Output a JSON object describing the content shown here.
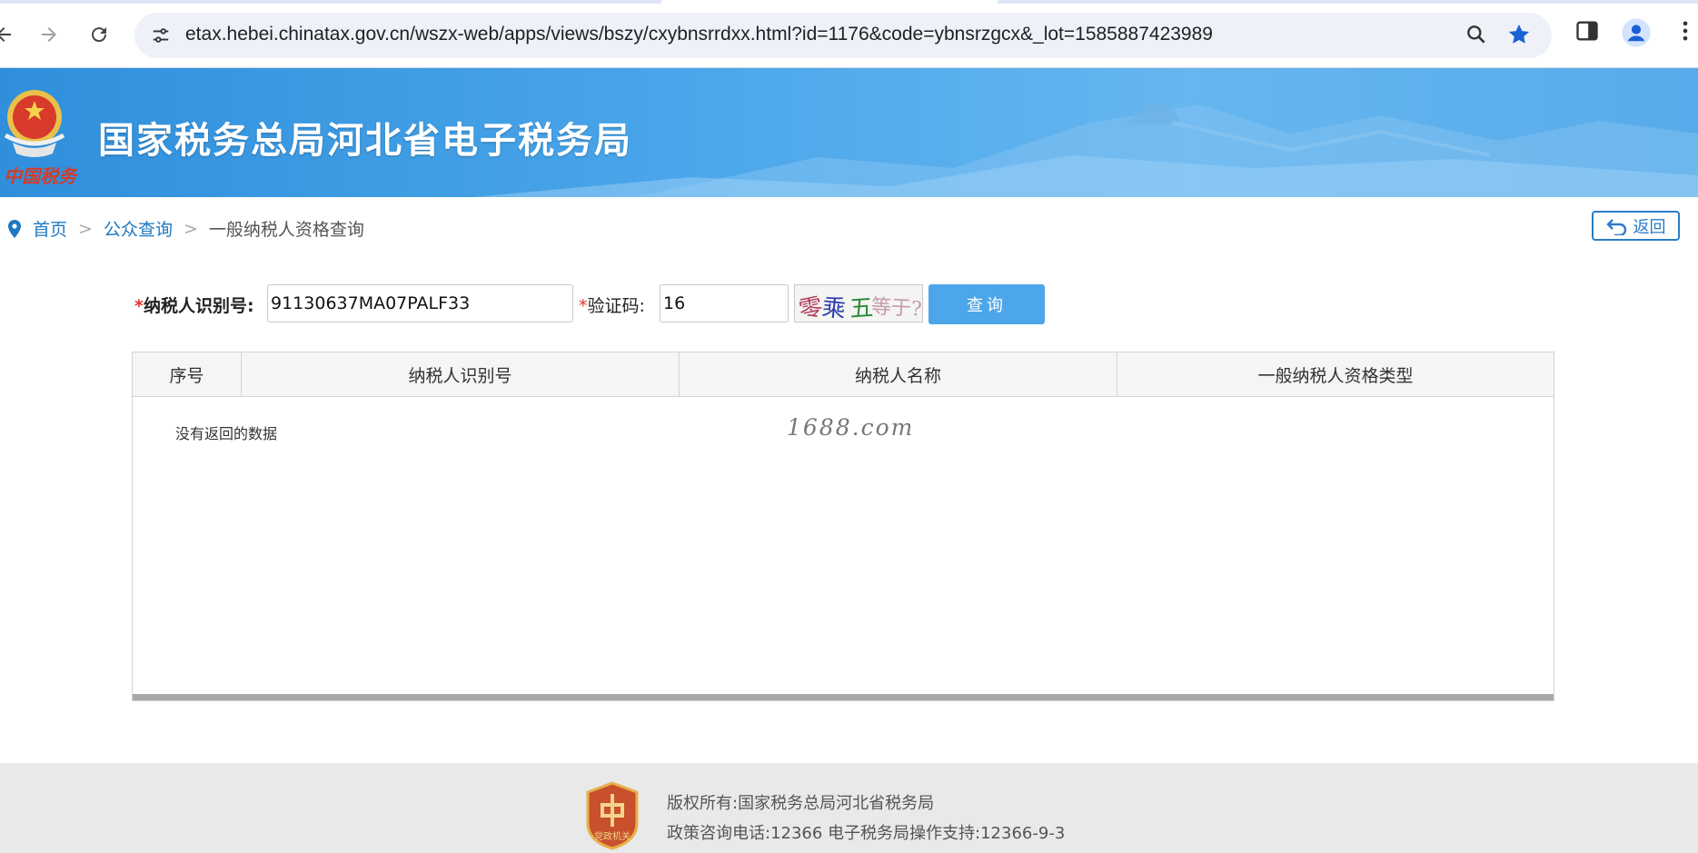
{
  "browser": {
    "url": "etax.hebei.chinatax.gov.cn/wszx-web/apps/views/bszy/cxybnsrrdxx.html?id=1176&code=ybnsrzgcx&_lot=1585887423989"
  },
  "banner": {
    "title": "国家税务总局河北省电子税务局",
    "signature": "中国税务"
  },
  "breadcrumb": {
    "home": "首页",
    "sep1": ">",
    "public_query": "公众查询",
    "sep2": ">",
    "current": "一般纳税人资格查询"
  },
  "back_button": "返回",
  "form": {
    "taxpayer_id_required": "*",
    "taxpayer_id_label": "纳税人识别号:",
    "taxpayer_id_value": "91130637MA07PALF33",
    "captcha_required": "*",
    "captcha_label": "验证码:",
    "captcha_value": "16",
    "captcha_image_text": [
      "零",
      "乘",
      "五",
      "等于?"
    ],
    "query_button": "查询"
  },
  "table": {
    "columns": [
      "序号",
      "纳税人识别号",
      "纳税人名称",
      "一般纳税人资格类型"
    ],
    "empty_text": "没有返回的数据",
    "watermark": "1688.com"
  },
  "footer": {
    "copyright": "版权所有:国家税务总局河北省税务局",
    "contact": "政策咨询电话:12366  电子税务局操作支持:12366-9-3",
    "badge_text": "党政机关"
  },
  "colors": {
    "banner": "#3a98e2",
    "query_button": "#4ea6ea",
    "link": "#1f78c1",
    "required": "#e0322b",
    "footer_bg": "#e9e9e9"
  }
}
